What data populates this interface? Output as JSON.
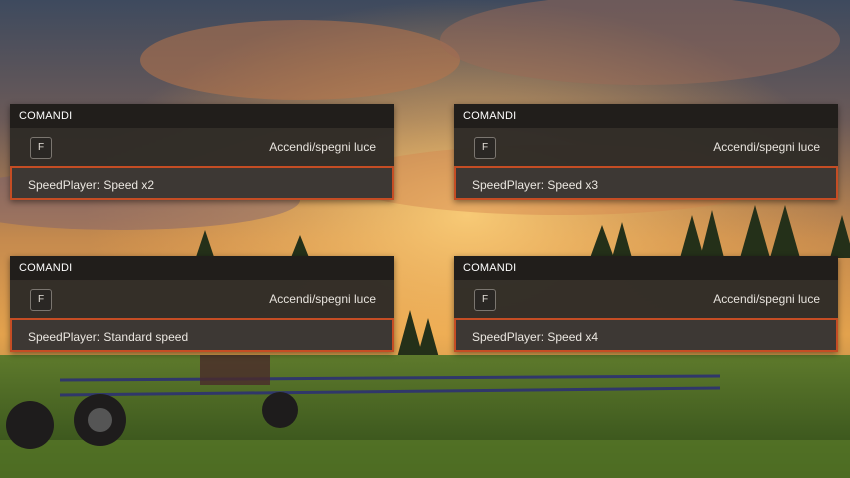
{
  "panels": [
    {
      "header": "COMANDI",
      "key": "F",
      "key_action": "Accendi/spegni luce",
      "selected": "SpeedPlayer: Speed x2"
    },
    {
      "header": "COMANDI",
      "key": "F",
      "key_action": "Accendi/spegni luce",
      "selected": "SpeedPlayer: Speed x3"
    },
    {
      "header": "COMANDI",
      "key": "F",
      "key_action": "Accendi/spegni luce",
      "selected": "SpeedPlayer: Standard speed"
    },
    {
      "header": "COMANDI",
      "key": "F",
      "key_action": "Accendi/spegni luce",
      "selected": "SpeedPlayer: Speed x4"
    }
  ],
  "colors": {
    "accent": "#c54d24",
    "panel": "#2c2824",
    "header": "#211e1b"
  }
}
